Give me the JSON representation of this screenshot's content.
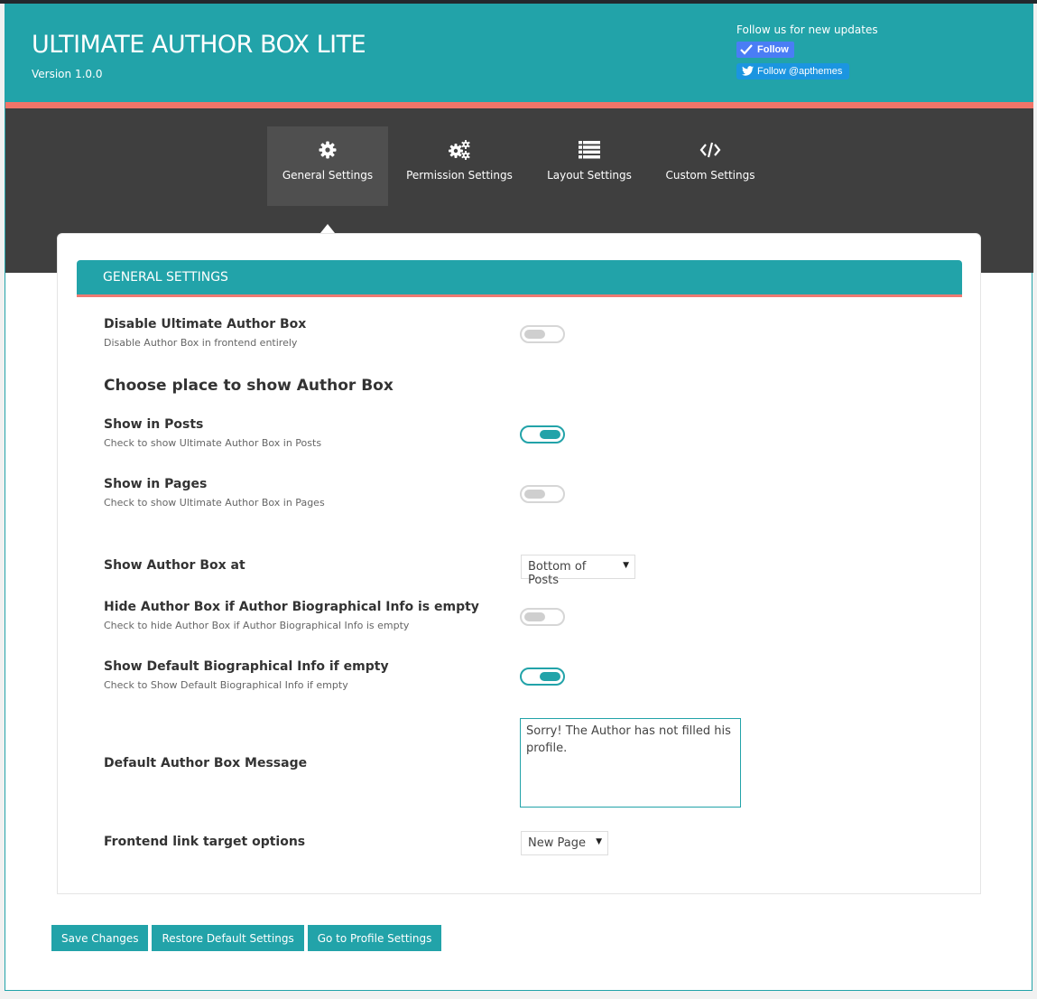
{
  "header": {
    "title": "ULTIMATE AUTHOR BOX LITE",
    "version": "Version 1.0.0",
    "follow_text": "Follow us for new updates",
    "follow_button": "Follow",
    "twitter_button": "Follow @apthemes"
  },
  "tabs": [
    {
      "label": "General Settings",
      "icon": "gear-icon",
      "active": true
    },
    {
      "label": "Permission Settings",
      "icon": "gears-icon",
      "active": false
    },
    {
      "label": "Layout Settings",
      "icon": "list-icon",
      "active": false
    },
    {
      "label": "Custom Settings",
      "icon": "code-icon",
      "active": false
    }
  ],
  "section": {
    "title": "GENERAL SETTINGS",
    "disable": {
      "label": "Disable Ultimate Author Box",
      "desc": "Disable Author Box in frontend entirely",
      "checked": false
    },
    "place_heading": "Choose place to show Author Box",
    "posts": {
      "label": "Show in Posts",
      "desc": "Check to show Ultimate Author Box in Posts",
      "checked": true
    },
    "pages": {
      "label": "Show in Pages",
      "desc": "Check to show Ultimate Author Box in Pages",
      "checked": false
    },
    "position": {
      "label": "Show Author Box at",
      "value": "Bottom of Posts"
    },
    "hide_empty": {
      "label": "Hide Author Box if Author Biographical Info is empty",
      "desc": "Check to hide Author Box if Author Biographical Info is empty",
      "checked": false
    },
    "default_bio": {
      "label": "Show Default Biographical Info if empty",
      "desc": "Check to Show Default Biographical Info if empty",
      "checked": true
    },
    "message": {
      "label": "Default Author Box Message",
      "value": "Sorry! The Author has not filled his profile."
    },
    "link_target": {
      "label": "Frontend link target options",
      "value": "New Page"
    }
  },
  "actions": {
    "save": "Save Changes",
    "restore": "Restore Default Settings",
    "profile": "Go to Profile Settings"
  },
  "colors": {
    "primary": "#22a3a9",
    "accent": "#f27468",
    "dark": "#3f3f3f"
  }
}
